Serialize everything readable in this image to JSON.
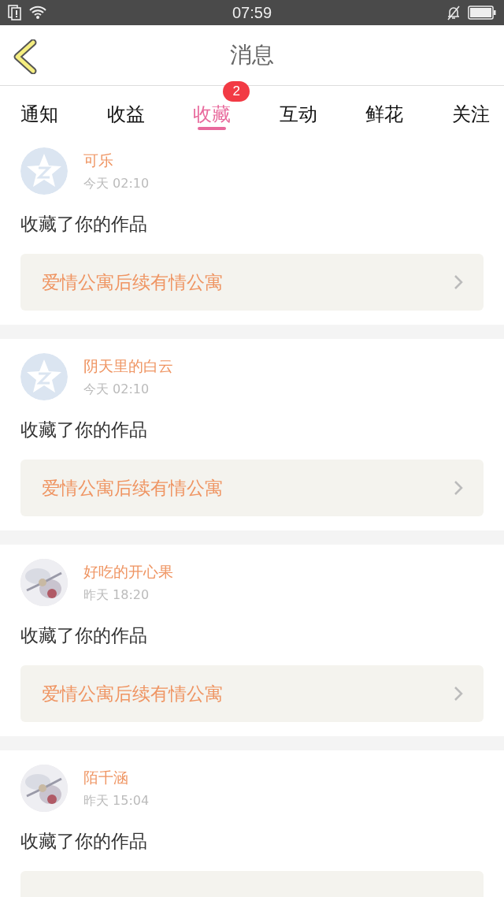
{
  "status_bar": {
    "time": "07:59"
  },
  "header": {
    "title": "消息"
  },
  "tabs": [
    {
      "label": "通知",
      "selected": false
    },
    {
      "label": "收益",
      "selected": false
    },
    {
      "label": "收藏",
      "selected": true,
      "badge": "2"
    },
    {
      "label": "互动",
      "selected": false
    },
    {
      "label": "鲜花",
      "selected": false
    },
    {
      "label": "关注",
      "selected": false
    }
  ],
  "messages": [
    {
      "avatar": {
        "kind": "default"
      },
      "name": "可乐",
      "time": "今天 02:10",
      "text": "收藏了你的作品",
      "work_title": "爱情公寓后续有情公寓"
    },
    {
      "avatar": {
        "kind": "default"
      },
      "name": "阴天里的白云",
      "time": "今天 02:10",
      "text": "收藏了你的作品",
      "work_title": "爱情公寓后续有情公寓"
    },
    {
      "name": "好吃的开心果",
      "time": "昨天 18:20",
      "text": "收藏了你的作品",
      "work_title": "爱情公寓后续有情公寓"
    },
    {
      "name": "陌千涵",
      "time": "昨天 15:04",
      "text": "收藏了你的作品",
      "work_cut": true
    }
  ]
}
